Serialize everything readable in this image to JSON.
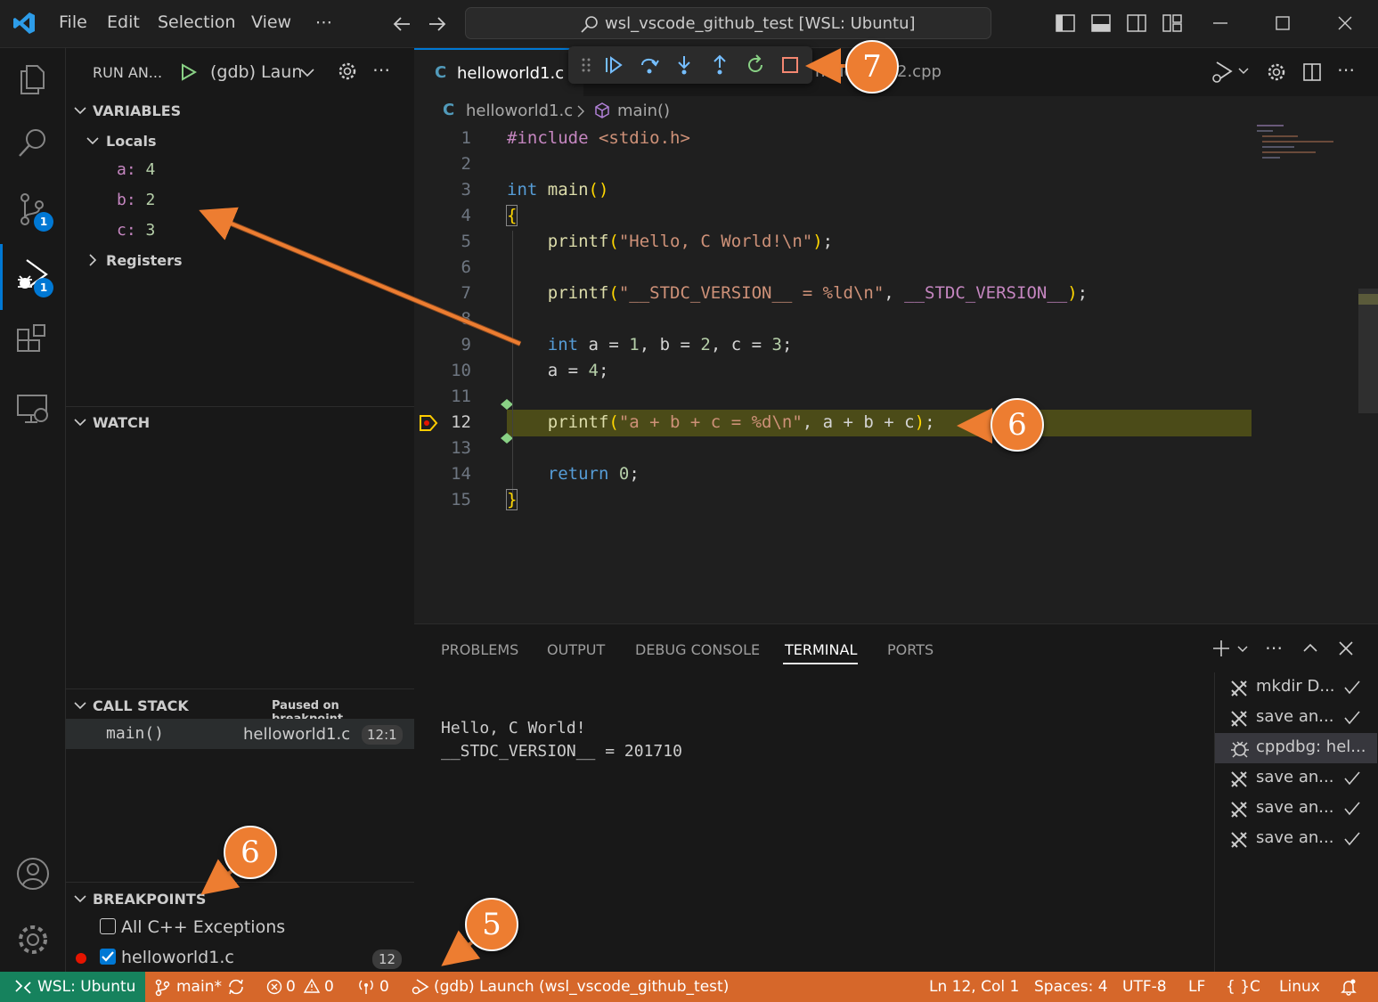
{
  "titlebar": {
    "menus": [
      "File",
      "Edit",
      "Selection",
      "View",
      "⋯"
    ],
    "command_center": "wsl_vscode_github_test [WSL: Ubuntu]"
  },
  "activity": {
    "scm_badge": "1",
    "debug_badge": "1"
  },
  "sidebar": {
    "run_label": "RUN AN...",
    "config_name": "(gdb) Laun",
    "variables_title": "VARIABLES",
    "locals_title": "Locals",
    "locals": [
      {
        "name": "a:",
        "value": "4"
      },
      {
        "name": "b:",
        "value": "2"
      },
      {
        "name": "c:",
        "value": "3"
      }
    ],
    "registers_title": "Registers",
    "watch_title": "WATCH",
    "callstack_title": "CALL STACK",
    "callstack_status": "Paused on breakpoint",
    "frame_name": "main()",
    "frame_file": "helloworld1.c",
    "frame_pos": "12:1",
    "breakpoints_title": "BREAKPOINTS",
    "bp_exceptions": "All C++ Exceptions",
    "bp_file": "helloworld1.c",
    "bp_line": "12"
  },
  "editor": {
    "tab_active": "helloworld1.c",
    "tab_other_prefix": "hello",
    "tab_other_suffix": "2.cpp",
    "tab_lang_icon": "C",
    "breadcrumb_file": "helloworld1.c",
    "breadcrumb_symbol": "main()",
    "line_numbers": [
      "1",
      "2",
      "3",
      "4",
      "5",
      "6",
      "7",
      "8",
      "9",
      "10",
      "11",
      "12",
      "13",
      "14",
      "15"
    ]
  },
  "panel": {
    "tabs": [
      "PROBLEMS",
      "OUTPUT",
      "DEBUG CONSOLE",
      "TERMINAL",
      "PORTS"
    ],
    "active_tab": "TERMINAL",
    "terminal_lines": [
      "Hello, C World!",
      "__STDC_VERSION__ = 201710"
    ],
    "terminals": [
      "mkdir D...",
      "save an...",
      "cppdbg: hel...",
      "save an...",
      "save an...",
      "save an..."
    ]
  },
  "statusbar": {
    "remote": "WSL: Ubuntu",
    "branch": "main*",
    "errors": "0",
    "warnings": "0",
    "ports": "0",
    "launch": "(gdb) Launch (wsl_vscode_github_test)",
    "position": "Ln 12, Col 1",
    "spaces": "Spaces: 4",
    "encoding": "UTF-8",
    "eol": "LF",
    "language": "C",
    "os": "Linux"
  },
  "callouts": {
    "debug_toolbar": "7",
    "current_line": "6",
    "breakpoints": "6",
    "statusbar": "5"
  },
  "colors": {
    "statusbar_debug": "#d6672a",
    "remote": "#16825d",
    "callout": "#ed7d31",
    "current_line": "#4b4b18"
  }
}
